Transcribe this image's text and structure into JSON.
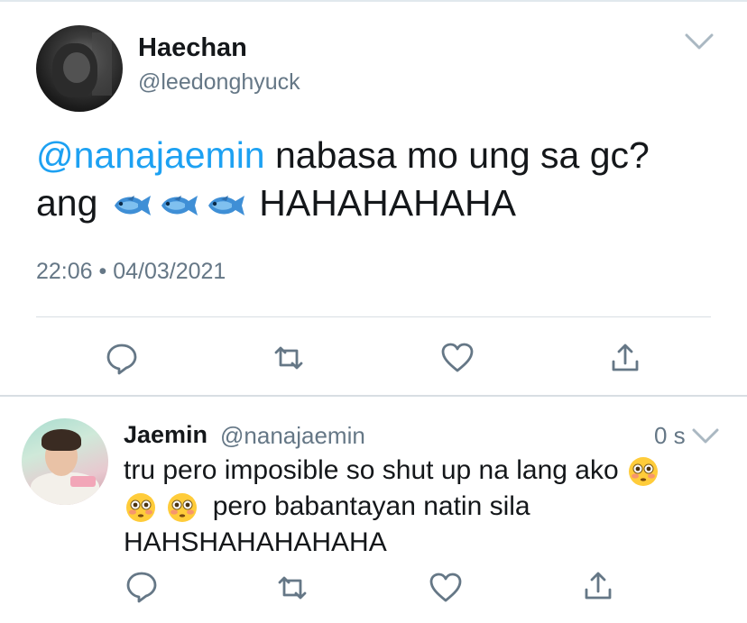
{
  "main_tweet": {
    "author_name": "Haechan",
    "author_handle": "@leedonghyuck",
    "mention": "@nanajaemin",
    "text_part1": " nabasa mo ung sa gc?",
    "text_part2_prefix": "ang",
    "text_part2_suffix": "HAHAHAHAHA",
    "emoji": [
      "fish-emoji",
      "fish-emoji",
      "fish-emoji"
    ],
    "timestamp": "22:06 • 04/03/2021",
    "actions": [
      "reply-icon",
      "retweet-icon",
      "like-icon",
      "share-icon"
    ]
  },
  "reply_tweet": {
    "author_name": "Jaemin",
    "author_handle": "@nanajaemin",
    "time": "0 s",
    "line1": "tru pero imposible so shut up na lang ako",
    "line2": "pero babantayan natin sila",
    "line3": "HAHSHAHAHAHAHA",
    "emoji": [
      "flushed-face-emoji",
      "flushed-face-emoji",
      "flushed-face-emoji"
    ],
    "actions": [
      "reply-icon",
      "retweet-icon",
      "like-icon",
      "share-icon"
    ]
  },
  "colors": {
    "text": "#14171a",
    "secondary": "#657786",
    "mention": "#1da1f2",
    "divider": "#d8dee3"
  }
}
